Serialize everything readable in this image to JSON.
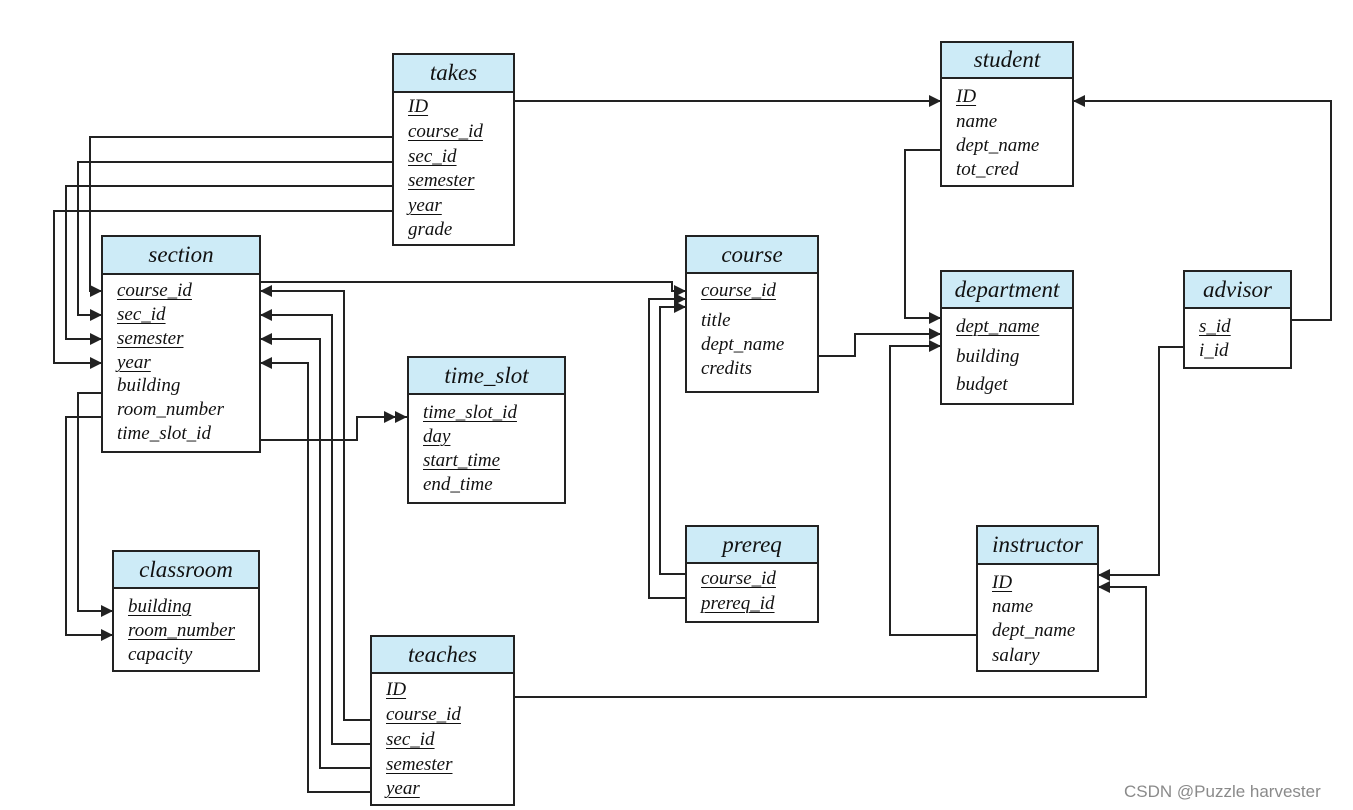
{
  "tables": [
    {
      "name": "takes",
      "attributes": [
        {
          "n": "ID",
          "pk": true
        },
        {
          "n": "course_id",
          "pk": true
        },
        {
          "n": "sec_id",
          "pk": true
        },
        {
          "n": "semester",
          "pk": true
        },
        {
          "n": "year",
          "pk": true
        },
        {
          "n": "grade",
          "pk": false
        }
      ]
    },
    {
      "name": "student",
      "attributes": [
        {
          "n": "ID",
          "pk": true
        },
        {
          "n": "name",
          "pk": false
        },
        {
          "n": "dept_name",
          "pk": false
        },
        {
          "n": "tot_cred",
          "pk": false
        }
      ]
    },
    {
      "name": "section",
      "attributes": [
        {
          "n": "course_id",
          "pk": true
        },
        {
          "n": "sec_id",
          "pk": true
        },
        {
          "n": "semester",
          "pk": true
        },
        {
          "n": "year",
          "pk": true
        },
        {
          "n": "building",
          "pk": false
        },
        {
          "n": "room_number",
          "pk": false
        },
        {
          "n": "time_slot_id",
          "pk": false
        }
      ]
    },
    {
      "name": "course",
      "attributes": [
        {
          "n": "course_id",
          "pk": true
        },
        {
          "n": "title",
          "pk": false
        },
        {
          "n": "dept_name",
          "pk": false
        },
        {
          "n": "credits",
          "pk": false
        }
      ]
    },
    {
      "name": "department",
      "attributes": [
        {
          "n": "dept_name",
          "pk": true
        },
        {
          "n": "building",
          "pk": false
        },
        {
          "n": "budget",
          "pk": false
        }
      ]
    },
    {
      "name": "advisor",
      "attributes": [
        {
          "n": "s_id",
          "pk": true
        },
        {
          "n": "i_id",
          "pk": false
        }
      ]
    },
    {
      "name": "time_slot",
      "attributes": [
        {
          "n": "time_slot_id",
          "pk": true
        },
        {
          "n": "day",
          "pk": true
        },
        {
          "n": "start_time",
          "pk": true
        },
        {
          "n": "end_time",
          "pk": false
        }
      ]
    },
    {
      "name": "prereq",
      "attributes": [
        {
          "n": "course_id",
          "pk": true
        },
        {
          "n": "prereq_id",
          "pk": true
        }
      ]
    },
    {
      "name": "instructor",
      "attributes": [
        {
          "n": "ID",
          "pk": true
        },
        {
          "n": "name",
          "pk": false
        },
        {
          "n": "dept_name",
          "pk": false
        },
        {
          "n": "salary",
          "pk": false
        }
      ]
    },
    {
      "name": "classroom",
      "attributes": [
        {
          "n": "building",
          "pk": true
        },
        {
          "n": "room_number",
          "pk": true
        },
        {
          "n": "capacity",
          "pk": false
        }
      ]
    },
    {
      "name": "teaches",
      "attributes": [
        {
          "n": "ID",
          "pk": true
        },
        {
          "n": "course_id",
          "pk": true
        },
        {
          "n": "sec_id",
          "pk": true
        },
        {
          "n": "semester",
          "pk": true
        },
        {
          "n": "year",
          "pk": true
        }
      ]
    }
  ],
  "relationships": [
    {
      "from": "takes.ID",
      "to": "student.ID"
    },
    {
      "from": "takes.course_id",
      "to": "section.course_id"
    },
    {
      "from": "takes.sec_id",
      "to": "section.sec_id"
    },
    {
      "from": "takes.semester",
      "to": "section.semester"
    },
    {
      "from": "takes.year",
      "to": "section.year"
    },
    {
      "from": "section.building",
      "to": "classroom.building"
    },
    {
      "from": "section.room_number",
      "to": "classroom.room_number"
    },
    {
      "from": "section.time_slot_id",
      "to": "time_slot.time_slot_id"
    },
    {
      "from": "teaches.course_id",
      "to": "section.course_id"
    },
    {
      "from": "teaches.sec_id",
      "to": "section.sec_id"
    },
    {
      "from": "teaches.semester",
      "to": "section.semester"
    },
    {
      "from": "teaches.year",
      "to": "section.year"
    },
    {
      "from": "section.course_id",
      "to": "course.course_id"
    },
    {
      "from": "prereq.course_id",
      "to": "course.course_id"
    },
    {
      "from": "prereq.prereq_id",
      "to": "course.course_id"
    },
    {
      "from": "student.dept_name",
      "to": "department.dept_name"
    },
    {
      "from": "course.dept_name",
      "to": "department.dept_name"
    },
    {
      "from": "instructor.dept_name",
      "to": "department.dept_name"
    },
    {
      "from": "advisor.s_id",
      "to": "student.ID"
    },
    {
      "from": "advisor.i_id",
      "to": "instructor.ID"
    },
    {
      "from": "teaches.ID",
      "to": "instructor.ID"
    }
  ],
  "colors": {
    "header": "#cdebf7",
    "line": "#222222"
  },
  "watermark": "CSDN @Puzzle harvester"
}
